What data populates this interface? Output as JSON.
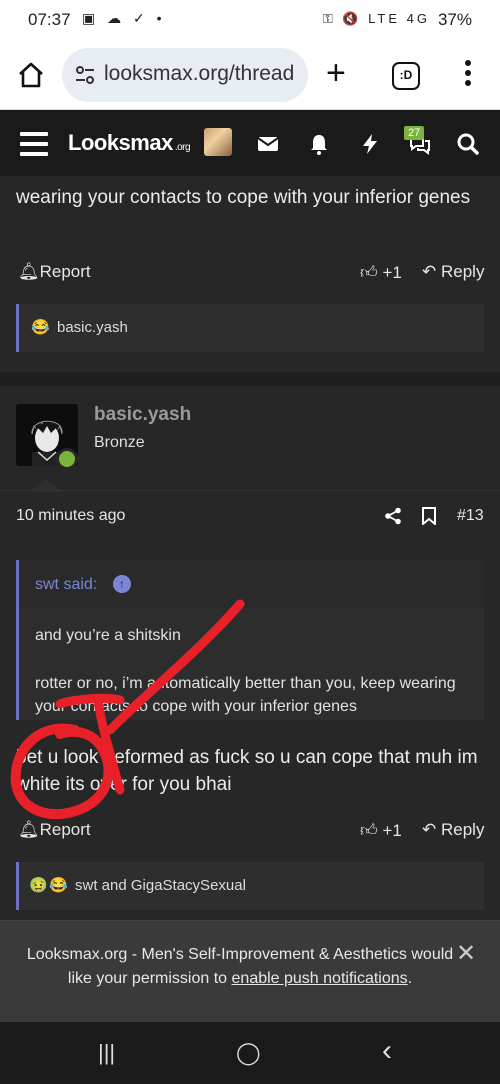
{
  "status_bar": {
    "time": "07:37",
    "left_icons": "▣ ☁ ✓ •",
    "right_icons": "⚿ 🔇 LTE 4G",
    "battery": "37%"
  },
  "browser": {
    "url": "looksmax.org/thread",
    "plus": "+",
    "tab_label": ":D",
    "menu": "⋮"
  },
  "site_nav": {
    "logo_text": "Looksmax",
    "logo_suffix": ".org",
    "badge_count": "27"
  },
  "prev_post": {
    "text": "wearing your contacts to cope with your inferior genes",
    "report": "Report",
    "like_count": "+1",
    "reply": "Reply",
    "reactions_text": "basic.yash"
  },
  "post": {
    "username": "basic.yash",
    "rank": "Bronze",
    "time": "10 minutes ago",
    "post_number": "#13",
    "quote": {
      "author": "swt said:",
      "line1": "and you’re a shitskin",
      "line2": "rotter or no, i’m automatically better than you, keep wearing your contacts to cope with your inferior genes"
    },
    "body": "bet u look deformed as fuck so u can cope that muh im white its over for you bhai",
    "report": "Report",
    "like_count": "+1",
    "reply": "Reply",
    "reactions_text": "swt and GigaStacySexual"
  },
  "notification": {
    "text_before": "Looksmax.org - Men's Self-Improvement & Aesthetics would like your permission to ",
    "link": "enable push notifications",
    "text_after": ".",
    "close": "✕"
  },
  "android_nav": {
    "recents": "|||",
    "home": "◯",
    "back": "‹"
  },
  "colors": {
    "accent_link": "#7b86d6",
    "online": "#7cb33a",
    "annotation": "#e8202a"
  }
}
